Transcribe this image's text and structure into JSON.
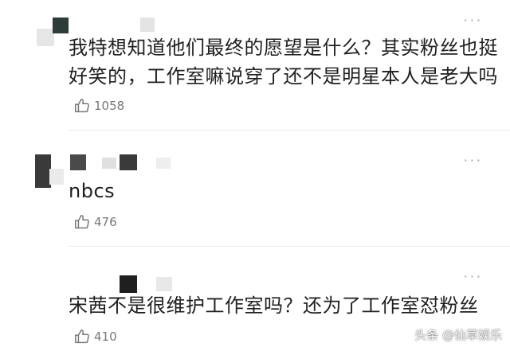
{
  "comments": [
    {
      "text_line1": "我特想知道他们最终的愿望是什么？其实粉丝也挺",
      "text_line2": "好笑的，工作室嘛说穿了还不是明星本人是老大吗",
      "likes": "1058",
      "more": "···"
    },
    {
      "text_line1": "nbcs",
      "likes": "476",
      "more": "···"
    },
    {
      "text_line1": "宋茜不是很维护工作室吗？还为了工作室怼粉丝",
      "likes": "410",
      "more": "···"
    }
  ],
  "watermark": "头条 @仙草娱乐",
  "icons": {
    "like": "thumbs-up-icon",
    "more": "more-dots-icon"
  }
}
